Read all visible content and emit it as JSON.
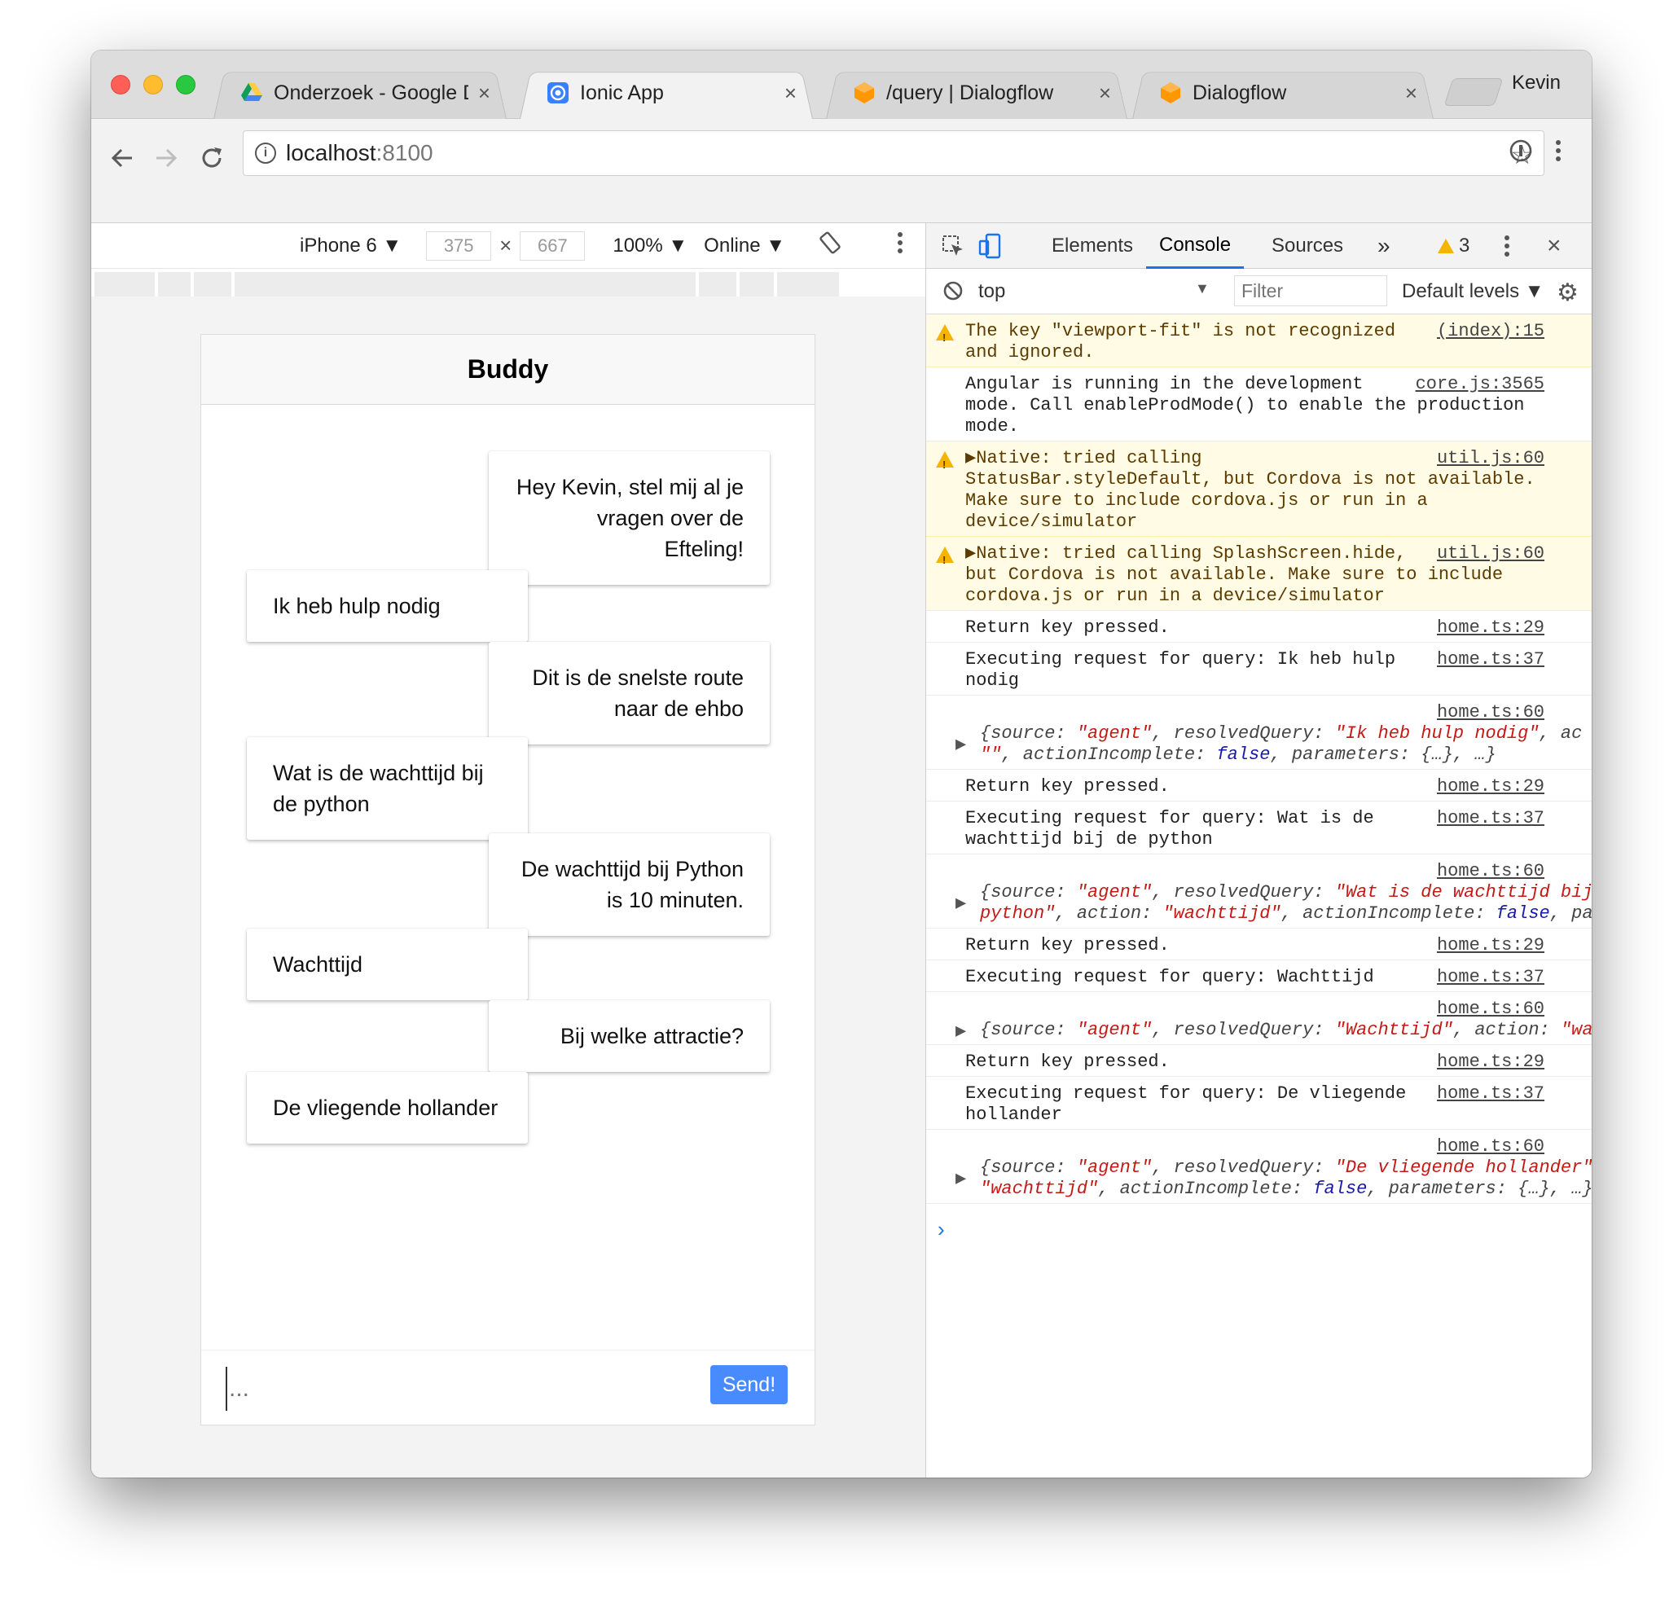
{
  "browser": {
    "tabs": [
      {
        "title": "Onderzoek - Google Dr",
        "icon": "google-drive-icon",
        "active": false
      },
      {
        "title": "Ionic App",
        "icon": "ionic-icon",
        "active": true
      },
      {
        "title": "/query  |  Dialogflow",
        "icon": "dialogflow-icon",
        "active": false
      },
      {
        "title": "Dialogflow",
        "icon": "dialogflow-icon",
        "active": false
      }
    ],
    "tab_close": "×",
    "profile_name": "Kevin",
    "url_host": "localhost",
    "url_port": ":8100"
  },
  "device_toolbar": {
    "device": "iPhone 6 ▼",
    "width": "375",
    "times": "×",
    "height": "667",
    "zoom": "100% ▼",
    "network": "Online ▼"
  },
  "app": {
    "title": "Buddy",
    "messages": [
      {
        "from": "bot",
        "text": "Hey Kevin, stel mij al je vragen over de Efteling!"
      },
      {
        "from": "user",
        "text": "Ik heb hulp nodig"
      },
      {
        "from": "bot",
        "text": "Dit is de snelste route naar de ehbo"
      },
      {
        "from": "user",
        "text": "Wat is de wachttijd bij de python"
      },
      {
        "from": "bot",
        "text": "De wachttijd bij Python is 10 minuten."
      },
      {
        "from": "user",
        "text": "Wachttijd"
      },
      {
        "from": "bot",
        "text": "Bij welke attractie?"
      },
      {
        "from": "user",
        "text": "De vliegende hollander"
      }
    ],
    "input_placeholder": "...",
    "send_label": "Send!"
  },
  "devtools": {
    "tabs": [
      "Elements",
      "Console",
      "Sources"
    ],
    "active_tab": "Console",
    "more": "»",
    "warning_count": "3",
    "context": "top",
    "filter_placeholder": "Filter",
    "levels": "Default levels ▼",
    "logs": [
      {
        "level": "warn",
        "text": "The key \"viewport-fit\" is not recognized\nand ignored.",
        "source": "(index):15"
      },
      {
        "level": "info",
        "text": "Angular is running in the development\nmode. Call enableProdMode() to enable the production\nmode.",
        "source": "core.js:3565"
      },
      {
        "level": "warn",
        "text": "▶Native: tried calling\nStatusBar.styleDefault, but Cordova is not available.\nMake sure to include cordova.js or run in a\ndevice/simulator",
        "source": "util.js:60"
      },
      {
        "level": "warn",
        "text": "▶Native: tried calling SplashScreen.hide,\nbut Cordova is not available. Make sure to include\ncordova.js or run in a device/simulator",
        "source": "util.js:60"
      },
      {
        "level": "info",
        "text": "Return key pressed.",
        "source": "home.ts:29"
      },
      {
        "level": "info",
        "text": "Executing request for query: Ik heb hulp\nnodig",
        "source": "home.ts:37"
      },
      {
        "level": "object",
        "source": "home.ts:60",
        "lines": [
          [
            [
              "p",
              "{source: "
            ],
            [
              "s",
              "\"agent\""
            ],
            [
              "p",
              ", resolvedQuery: "
            ],
            [
              "s",
              "\"Ik heb hulp nodig\""
            ],
            [
              "p",
              ", ac"
            ]
          ],
          [
            [
              "s",
              "\"\""
            ],
            [
              "p",
              ", actionIncomplete: "
            ],
            [
              "b",
              "false"
            ],
            [
              "p",
              ", parameters: {…}, …}"
            ]
          ]
        ]
      },
      {
        "level": "info",
        "text": "Return key pressed.",
        "source": "home.ts:29"
      },
      {
        "level": "info",
        "text": "Executing request for query: Wat is de\nwachttijd bij de python",
        "source": "home.ts:37"
      },
      {
        "level": "object",
        "source": "home.ts:60",
        "lines": [
          [
            [
              "p",
              "{source: "
            ],
            [
              "s",
              "\"agent\""
            ],
            [
              "p",
              ", resolvedQuery: "
            ],
            [
              "s",
              "\"Wat is de wachttijd bij"
            ]
          ],
          [
            [
              "s",
              "python\""
            ],
            [
              "p",
              ", action: "
            ],
            [
              "s",
              "\"wachttijd\""
            ],
            [
              "p",
              ", actionIncomplete: "
            ],
            [
              "b",
              "false"
            ],
            [
              "p",
              ", pa"
            ]
          ]
        ]
      },
      {
        "level": "info",
        "text": "Return key pressed.",
        "source": "home.ts:29"
      },
      {
        "level": "info",
        "text": "Executing request for query: Wachttijd",
        "source": "home.ts:37"
      },
      {
        "level": "object",
        "source": "home.ts:60",
        "lines": [
          [
            [
              "p",
              "{source: "
            ],
            [
              "s",
              "\"agent\""
            ],
            [
              "p",
              ", resolvedQuery: "
            ],
            [
              "s",
              "\"Wachttijd\""
            ],
            [
              "p",
              ", action: "
            ],
            [
              "s",
              "\"wa"
            ]
          ]
        ]
      },
      {
        "level": "info",
        "text": "Return key pressed.",
        "source": "home.ts:29"
      },
      {
        "level": "info",
        "text": "Executing request for query: De vliegende\nhollander",
        "source": "home.ts:37"
      },
      {
        "level": "object",
        "source": "home.ts:60",
        "lines": [
          [
            [
              "p",
              "{source: "
            ],
            [
              "s",
              "\"agent\""
            ],
            [
              "p",
              ", resolvedQuery: "
            ],
            [
              "s",
              "\"De vliegende hollander\""
            ]
          ],
          [
            [
              "s",
              "\"wachttijd\""
            ],
            [
              "p",
              ", actionIncomplete: "
            ],
            [
              "b",
              "false"
            ],
            [
              "p",
              ", parameters: {…}, …}"
            ]
          ]
        ]
      }
    ],
    "prompt": "›"
  },
  "colors": {
    "accent": "#488aff",
    "devtools_active": "#1a73e8",
    "warning_bg": "#fffbe5"
  }
}
